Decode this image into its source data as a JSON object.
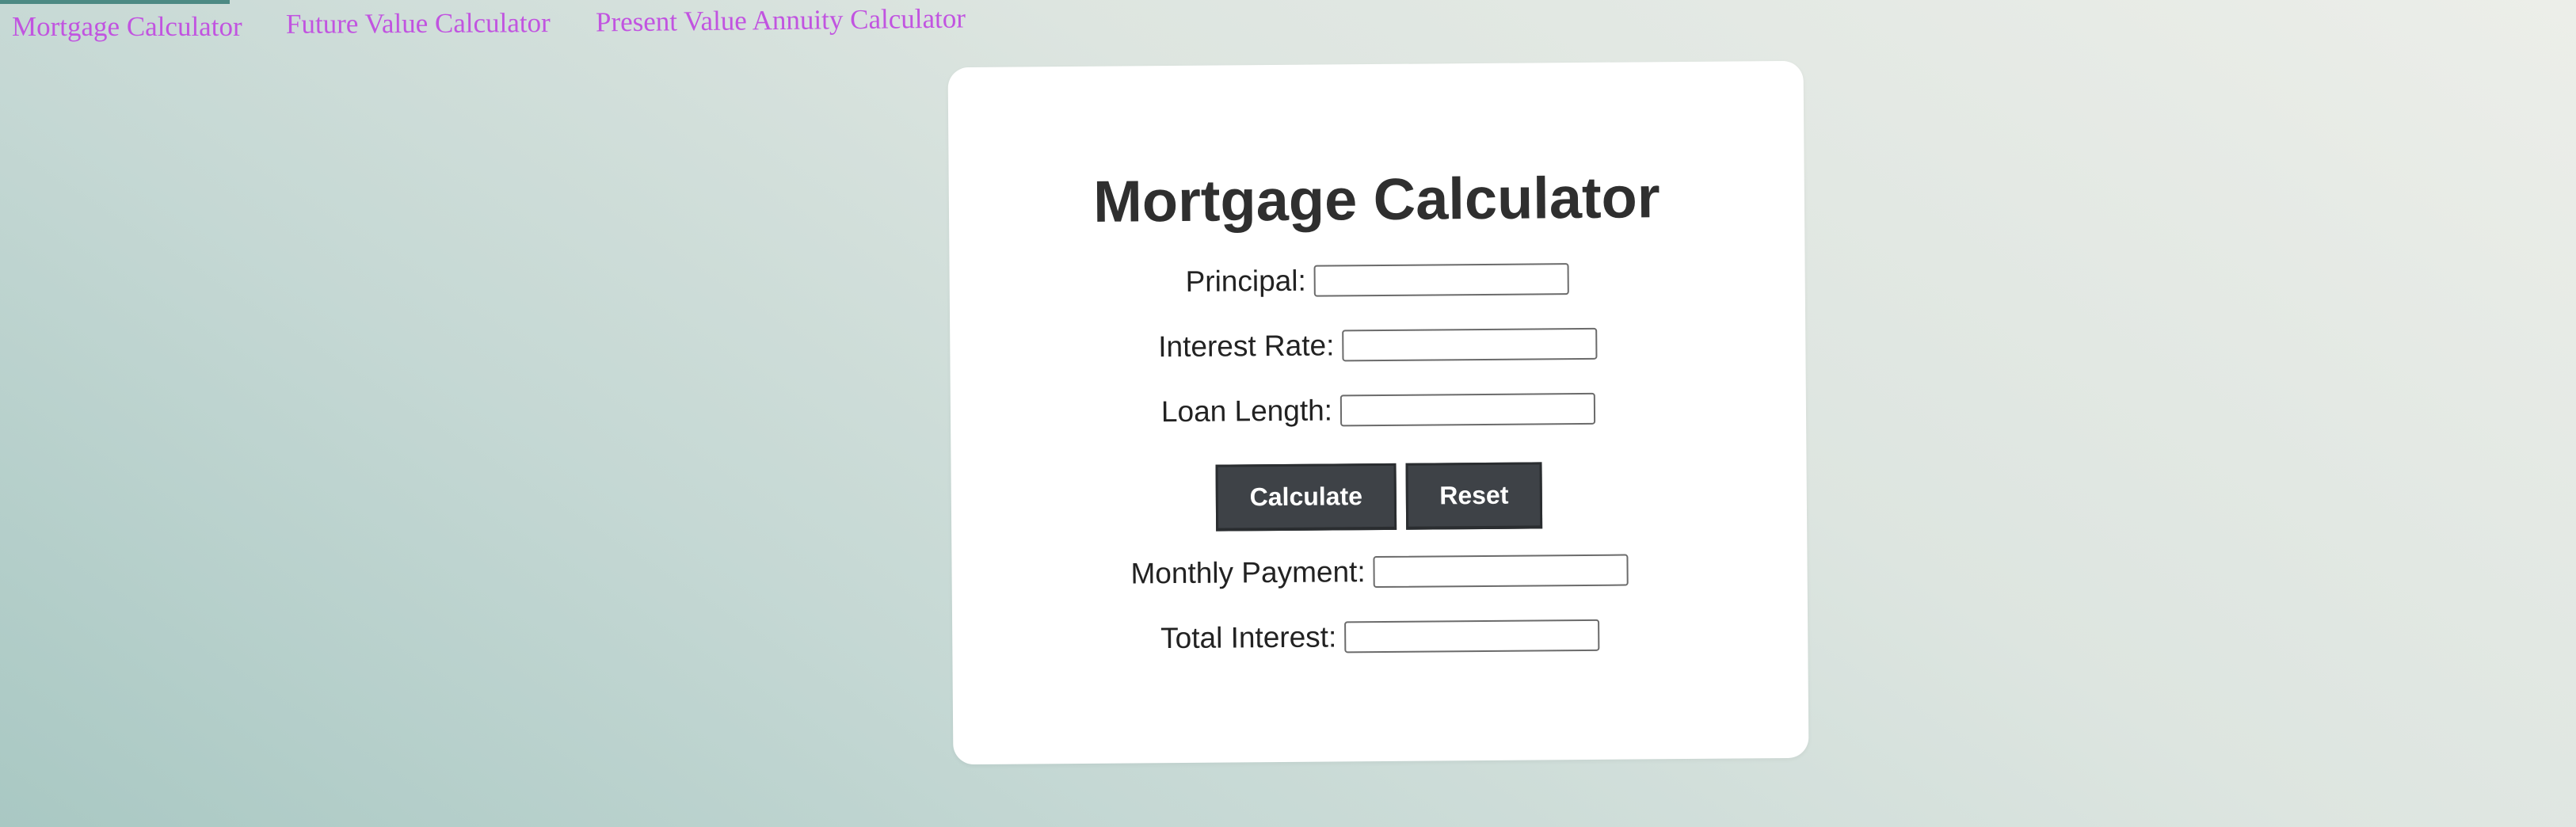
{
  "nav": {
    "links": [
      {
        "label": "Mortgage Calculator"
      },
      {
        "label": "Future Value Calculator"
      },
      {
        "label": "Present Value Annuity Calculator"
      }
    ]
  },
  "colors": {
    "link": "#c154e0",
    "button_bg": "#3e4247",
    "card_bg": "#ffffff",
    "title": "#2f2f2f"
  },
  "card": {
    "title": "Mortgage Calculator",
    "fields": {
      "principal": {
        "label": "Principal:",
        "value": ""
      },
      "interest_rate": {
        "label": "Interest Rate:",
        "value": ""
      },
      "loan_length": {
        "label": "Loan Length:",
        "value": ""
      },
      "monthly_payment": {
        "label": "Monthly Payment:",
        "value": ""
      },
      "total_interest": {
        "label": "Total Interest:",
        "value": ""
      }
    },
    "buttons": {
      "calculate": "Calculate",
      "reset": "Reset"
    }
  }
}
